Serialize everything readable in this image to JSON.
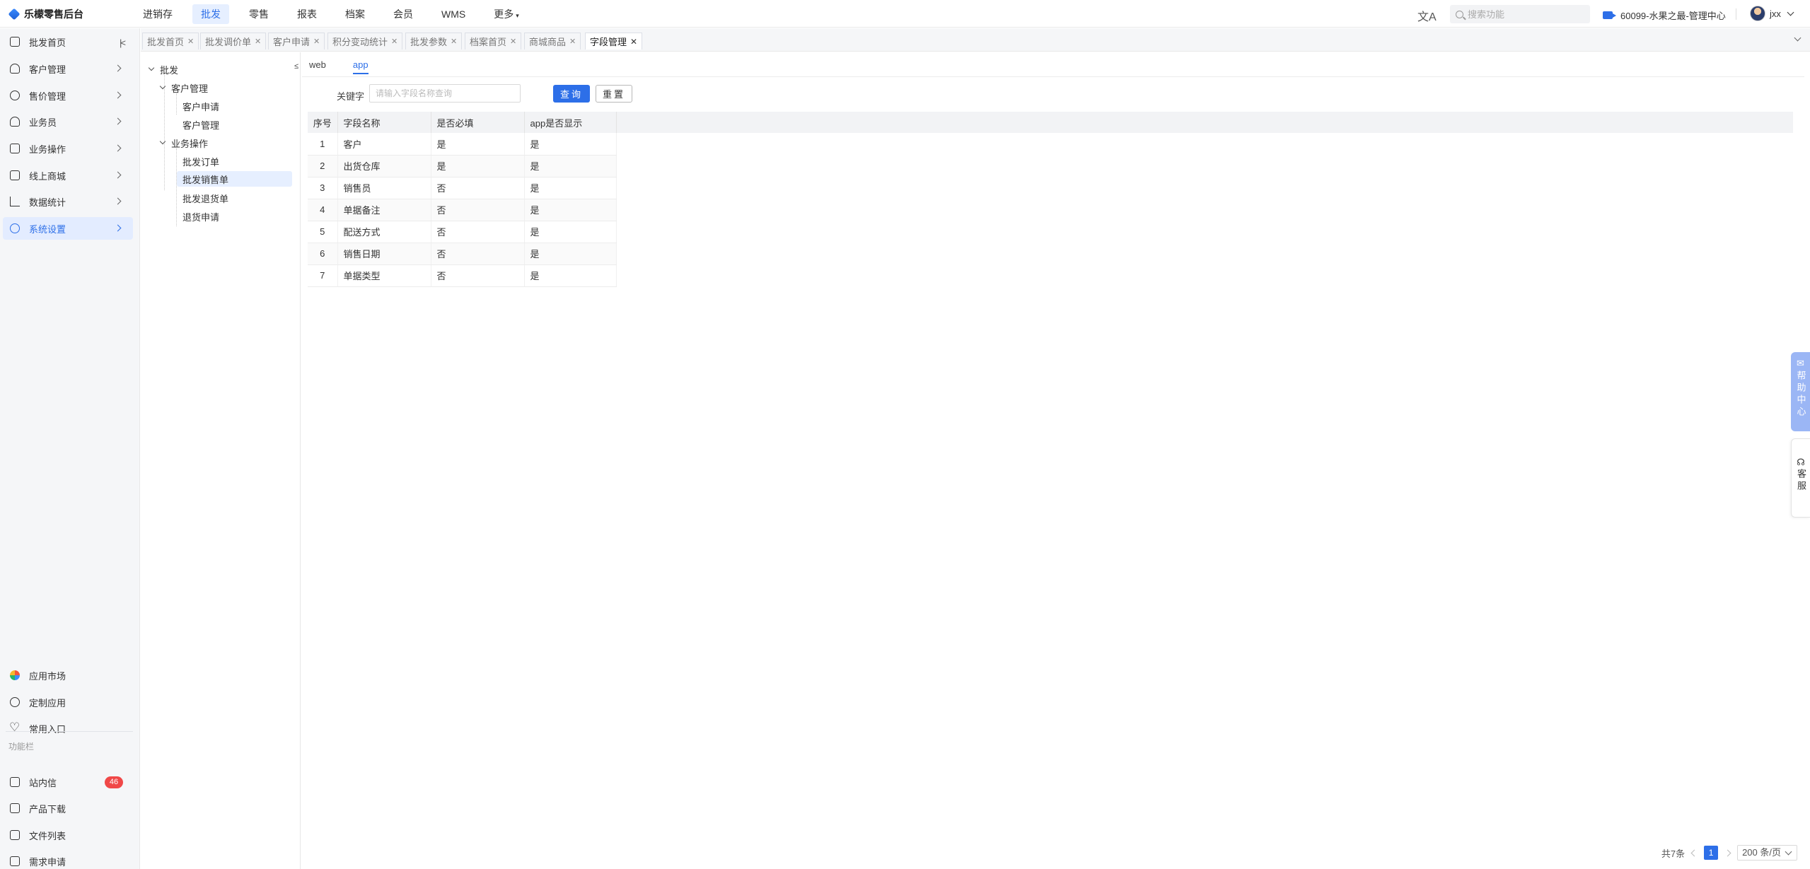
{
  "app": {
    "title": "乐檬零售后台",
    "brand_color": "#2d6fe8"
  },
  "topnav": {
    "items": [
      "进销存",
      "批发",
      "零售",
      "报表",
      "档案",
      "会员",
      "WMS",
      "更多"
    ],
    "active": "批发",
    "translate_icon": "translate-icon",
    "search_placeholder": "搜索功能",
    "org": "60099-水果之最-管理中心",
    "user": "jxx"
  },
  "sidebar": {
    "main_items": [
      {
        "label": "批发首页",
        "icon": "home-icon"
      },
      {
        "label": "客户管理",
        "icon": "user-icon"
      },
      {
        "label": "售价管理",
        "icon": "price-icon"
      },
      {
        "label": "业务员",
        "icon": "salesman-icon"
      },
      {
        "label": "业务操作",
        "icon": "operation-icon"
      },
      {
        "label": "线上商城",
        "icon": "store-icon"
      },
      {
        "label": "数据统计",
        "icon": "chart-icon"
      },
      {
        "label": "系统设置",
        "icon": "settings-icon"
      }
    ],
    "active": "系统设置",
    "bottom_items": [
      {
        "label": "应用市场",
        "icon": "app-market-icon"
      },
      {
        "label": "定制应用",
        "icon": "custom-app-icon"
      },
      {
        "label": "常用入口",
        "icon": "heart-icon"
      }
    ],
    "function_section": "功能栏",
    "function_items": [
      {
        "label": "站内信",
        "icon": "message-icon",
        "badge": "46"
      },
      {
        "label": "产品下载",
        "icon": "download-icon"
      },
      {
        "label": "文件列表",
        "icon": "file-list-icon"
      },
      {
        "label": "需求申请",
        "icon": "request-icon"
      }
    ]
  },
  "tabs": {
    "items": [
      "批发首页",
      "批发调价单",
      "客户申请",
      "积分变动统计",
      "批发参数",
      "档案首页",
      "商城商品",
      "字段管理"
    ],
    "active": "字段管理"
  },
  "tree": {
    "root": "批发",
    "groups": [
      {
        "label": "客户管理",
        "children": [
          "客户申请",
          "客户管理"
        ]
      },
      {
        "label": "业务操作",
        "children": [
          "批发订单",
          "批发销售单",
          "批发退货单",
          "退货申请"
        ]
      }
    ],
    "selected": "批发销售单"
  },
  "content": {
    "subtabs": [
      "web",
      "app"
    ],
    "active_subtab": "app",
    "filter": {
      "label": "关键字",
      "placeholder": "请输入字段名称查询",
      "value": "",
      "query_button": "查询",
      "reset_button": "重置"
    },
    "table": {
      "columns": [
        "序号",
        "字段名称",
        "是否必填",
        "app是否显示"
      ],
      "rows": [
        [
          "1",
          "客户",
          "是",
          "是"
        ],
        [
          "2",
          "出货仓库",
          "是",
          "是"
        ],
        [
          "3",
          "销售员",
          "否",
          "是"
        ],
        [
          "4",
          "单据备注",
          "否",
          "是"
        ],
        [
          "5",
          "配送方式",
          "否",
          "是"
        ],
        [
          "6",
          "销售日期",
          "否",
          "是"
        ],
        [
          "7",
          "单据类型",
          "否",
          "是"
        ]
      ]
    },
    "pagination": {
      "total": "共7条",
      "current_page": "1",
      "page_size": "200 条/页"
    }
  },
  "floating": {
    "help": "帮助中心",
    "service": "客服"
  }
}
